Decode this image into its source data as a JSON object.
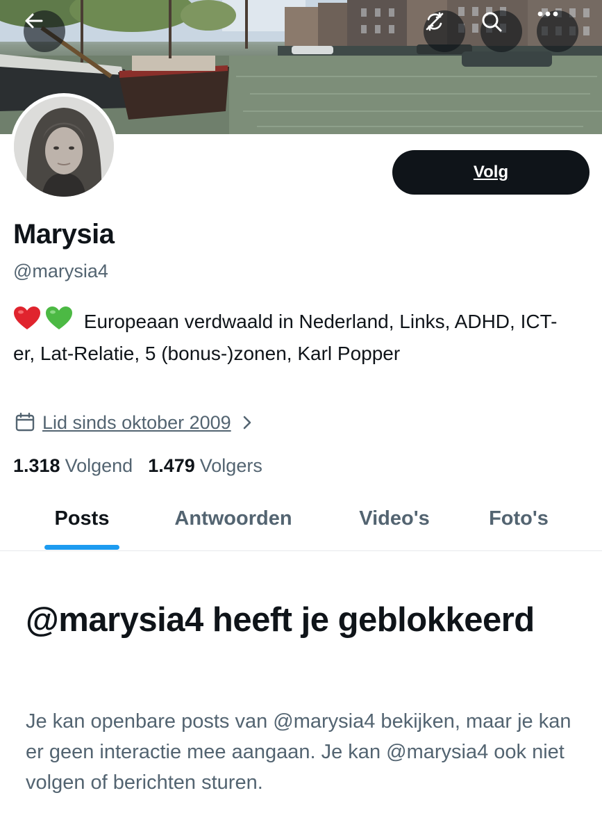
{
  "colors": {
    "text_primary": "#0f1419",
    "text_secondary": "#536471",
    "accent": "#1d9bf0",
    "button_bg": "#0f1419",
    "heart_red": "#e0242e",
    "heart_green": "#4cb944"
  },
  "header": {
    "back_icon": "arrow-left-icon",
    "sync_icon": "sync-off-icon",
    "search_icon": "search-icon",
    "more_icon": "more-horizontal-icon"
  },
  "profile": {
    "display_name": "Marysia",
    "handle": "@marysia4",
    "follow_label": "Volg",
    "bio_text": "Europeaan verdwaald in Nederland, Links, ADHD, ICT-er, Lat-Relatie, 5 (bonus-)zonen, Karl Popper",
    "bio_emojis": [
      "red-heart-emoji",
      "green-heart-emoji"
    ],
    "joined": "Lid sinds oktober 2009",
    "following_count": "1.318",
    "following_label": "Volgend",
    "followers_count": "1.479",
    "followers_label": "Volgers"
  },
  "tabs": [
    {
      "label": "Posts",
      "active": true
    },
    {
      "label": "Antwoorden",
      "active": false
    },
    {
      "label": "Video's",
      "active": false
    },
    {
      "label": "Foto's",
      "active": false
    }
  ],
  "blocked": {
    "title": "@marysia4 heeft je geblokkeerd",
    "message": "Je kan openbare posts van @marysia4 bekijken, maar je kan er geen interactie mee aangaan. Je kan @marysia4 ook niet volgen of berichten sturen."
  }
}
